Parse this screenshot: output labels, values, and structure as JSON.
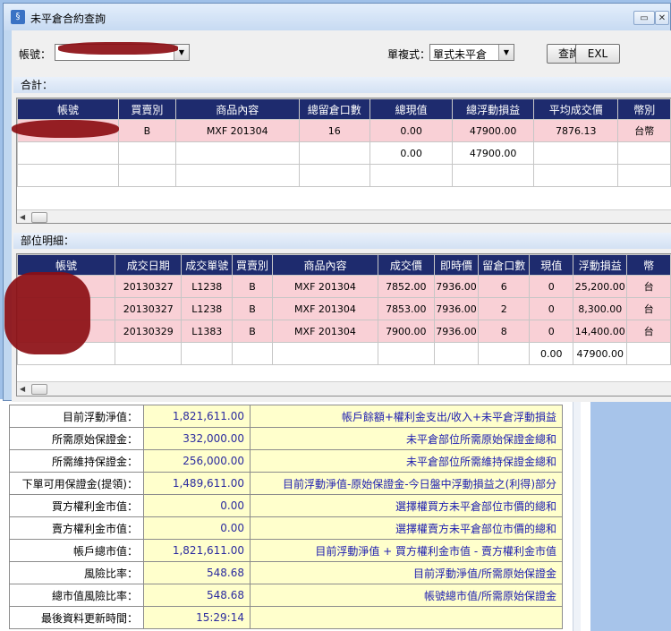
{
  "window": {
    "title": "未平倉合約查詢",
    "controls": [
      "restore-icon",
      "close-icon"
    ]
  },
  "toolbar": {
    "account_label": "帳號：",
    "account_value": "",
    "mode_label": "單複式：",
    "mode_value": "單式未平倉",
    "query_button": "查詢",
    "excel_button": "EXL"
  },
  "summary": {
    "label": "合計：",
    "columns": [
      "帳號",
      "買賣別",
      "商品內容",
      "總留倉口數",
      "總現值",
      "總浮動損益",
      "平均成交價",
      "幣別"
    ],
    "rows": [
      [
        "",
        "B",
        "MXF 201304",
        "16",
        "0.00",
        "47900.00",
        "7876.13",
        "台幣"
      ],
      [
        "",
        "",
        "",
        "",
        "0.00",
        "47900.00",
        "",
        ""
      ]
    ]
  },
  "detail": {
    "label": "部位明細：",
    "columns": [
      "帳號",
      "成交日期",
      "成交單號",
      "買賣別",
      "商品內容",
      "成交價",
      "即時價",
      "留倉口數",
      "現值",
      "浮動損益",
      "幣"
    ],
    "rows": [
      [
        "",
        "20130327",
        "L1238",
        "B",
        "MXF 201304",
        "7852.00",
        "7936.00",
        "6",
        "0",
        "25,200.00",
        "台"
      ],
      [
        "",
        "20130327",
        "L1238",
        "B",
        "MXF 201304",
        "7853.00",
        "7936.00",
        "2",
        "0",
        "8,300.00",
        "台"
      ],
      [
        "",
        "20130329",
        "L1383",
        "B",
        "MXF 201304",
        "7900.00",
        "7936.00",
        "8",
        "0",
        "14,400.00",
        "台"
      ],
      [
        "",
        "",
        "",
        "",
        "",
        "",
        "",
        "",
        "0.00",
        "47900.00",
        ""
      ]
    ]
  },
  "account_info": [
    {
      "label": "目前浮動淨值：",
      "value": "1,821,611.00",
      "desc": "帳戶餘額+權利金支出/收入+未平倉浮動損益"
    },
    {
      "label": "所需原始保證金：",
      "value": "332,000.00",
      "desc": "未平倉部位所需原始保證金總和"
    },
    {
      "label": "所需維持保證金：",
      "value": "256,000.00",
      "desc": "未平倉部位所需維持保證金總和"
    },
    {
      "label": "下單可用保證金(提領)：",
      "value": "1,489,611.00",
      "desc": "目前浮動淨值-原始保證金-今日盤中浮動損益之(利得)部分"
    },
    {
      "label": "買方權利金市值：",
      "value": "0.00",
      "desc": "選擇權買方未平倉部位市價的總和"
    },
    {
      "label": "賣方權利金市值：",
      "value": "0.00",
      "desc": "選擇權賣方未平倉部位市價的總和"
    },
    {
      "label": "帳戶總市值：",
      "value": "1,821,611.00",
      "desc": "目前浮動淨值 + 買方權利金市值 - 賣方權利金市值"
    },
    {
      "label": "風險比率：",
      "value": "548.68",
      "desc": "目前浮動淨值/所需原始保證金"
    },
    {
      "label": "總市值風險比率：",
      "value": "548.68",
      "desc": "帳號總市值/所需原始保證金"
    },
    {
      "label": "最後資料更新時間：",
      "value": "15:29:14",
      "desc": ""
    }
  ]
}
